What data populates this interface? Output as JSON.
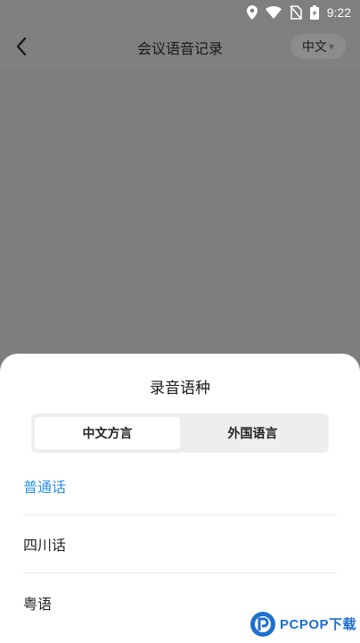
{
  "status_bar": {
    "time": "9:22",
    "icons": [
      "location-pin-icon",
      "wifi-icon",
      "no-sim-icon",
      "battery-charging-icon"
    ]
  },
  "header": {
    "title": "会议语音记录",
    "language_label": "中文",
    "back_icon": "chevron-left-icon",
    "caret_icon": "caret-down-icon"
  },
  "sheet": {
    "title": "录音语种",
    "tabs": [
      {
        "label": "中文方言",
        "active": true
      },
      {
        "label": "外国语言",
        "active": false
      }
    ],
    "options": [
      {
        "label": "普通话",
        "selected": true
      },
      {
        "label": "四川话",
        "selected": false
      },
      {
        "label": "粤语",
        "selected": false
      }
    ]
  },
  "watermark": {
    "text": "PCPOP下载"
  },
  "colors": {
    "accent": "#2a91e8",
    "overlay": "#7e7e7e",
    "watermark": "#1d6fd0"
  }
}
